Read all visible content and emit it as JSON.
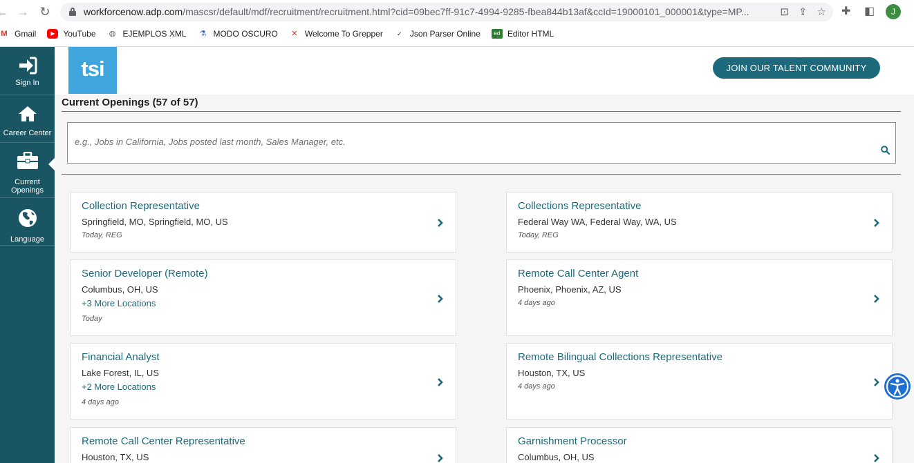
{
  "browser": {
    "url_host": "workforcenow.adp.com",
    "url_path": "/mascsr/default/mdf/recruitment/recruitment.html?cid=09bec7ff-91c7-4994-9285-fbea844b13af&ccId=19000101_000001&type=MP...",
    "profile_initial": "J",
    "bookmarks": [
      {
        "label": "Gmail",
        "icon": "gmail-icon"
      },
      {
        "label": "YouTube",
        "icon": "youtube-icon"
      },
      {
        "label": "EJEMPLOS XML",
        "icon": "globe-icon"
      },
      {
        "label": "MODO OSCURO",
        "icon": "flask-icon"
      },
      {
        "label": "Welcome To Grepper",
        "icon": "grepper-icon"
      },
      {
        "label": "Json Parser Online",
        "icon": "json-icon"
      },
      {
        "label": "Editor HTML",
        "icon": "editor-icon"
      }
    ]
  },
  "sidebar": {
    "items": [
      {
        "label": "Sign In",
        "icon": "sign-in-icon"
      },
      {
        "label": "Career Center",
        "icon": "home-icon"
      },
      {
        "label": "Current Openings",
        "icon": "briefcase-icon"
      },
      {
        "label": "Language",
        "icon": "globe-icon"
      }
    ]
  },
  "header": {
    "logo_text": "tsi",
    "join_button": "JOIN OUR TALENT COMMUNITY"
  },
  "openings": {
    "title": "Current Openings (57 of 57)",
    "search_placeholder": "e.g., Jobs in California, Jobs posted last month, Sales Manager, etc."
  },
  "jobs": [
    {
      "title": "Collection Representative",
      "location": "Springfield, MO, Springfield, MO, US",
      "more": "",
      "meta": "Today, REG"
    },
    {
      "title": "Collections Representative",
      "location": "Federal Way WA, Federal Way, WA, US",
      "more": "",
      "meta": "Today, REG"
    },
    {
      "title": "Senior Developer (Remote)",
      "location": "Columbus, OH, US",
      "more": "+3 More Locations",
      "meta": "Today"
    },
    {
      "title": "Remote Call Center Agent",
      "location": "Phoenix, Phoenix, AZ, US",
      "more": "",
      "meta": "4 days ago"
    },
    {
      "title": "Financial Analyst",
      "location": "Lake Forest, IL, US",
      "more": "+2 More Locations",
      "meta": "4 days ago"
    },
    {
      "title": "Remote Bilingual Collections Representative",
      "location": "Houston, TX, US",
      "more": "",
      "meta": "4 days ago"
    },
    {
      "title": "Remote Call Center Representative",
      "location": "Houston, TX, US",
      "more": "",
      "meta": ""
    },
    {
      "title": "Garnishment Processor",
      "location": "Columbus, OH, US",
      "more": "",
      "meta": ""
    }
  ],
  "colors": {
    "sidebar": "#1a5563",
    "accent": "#1c6a7c",
    "logo": "#41a5dd"
  }
}
